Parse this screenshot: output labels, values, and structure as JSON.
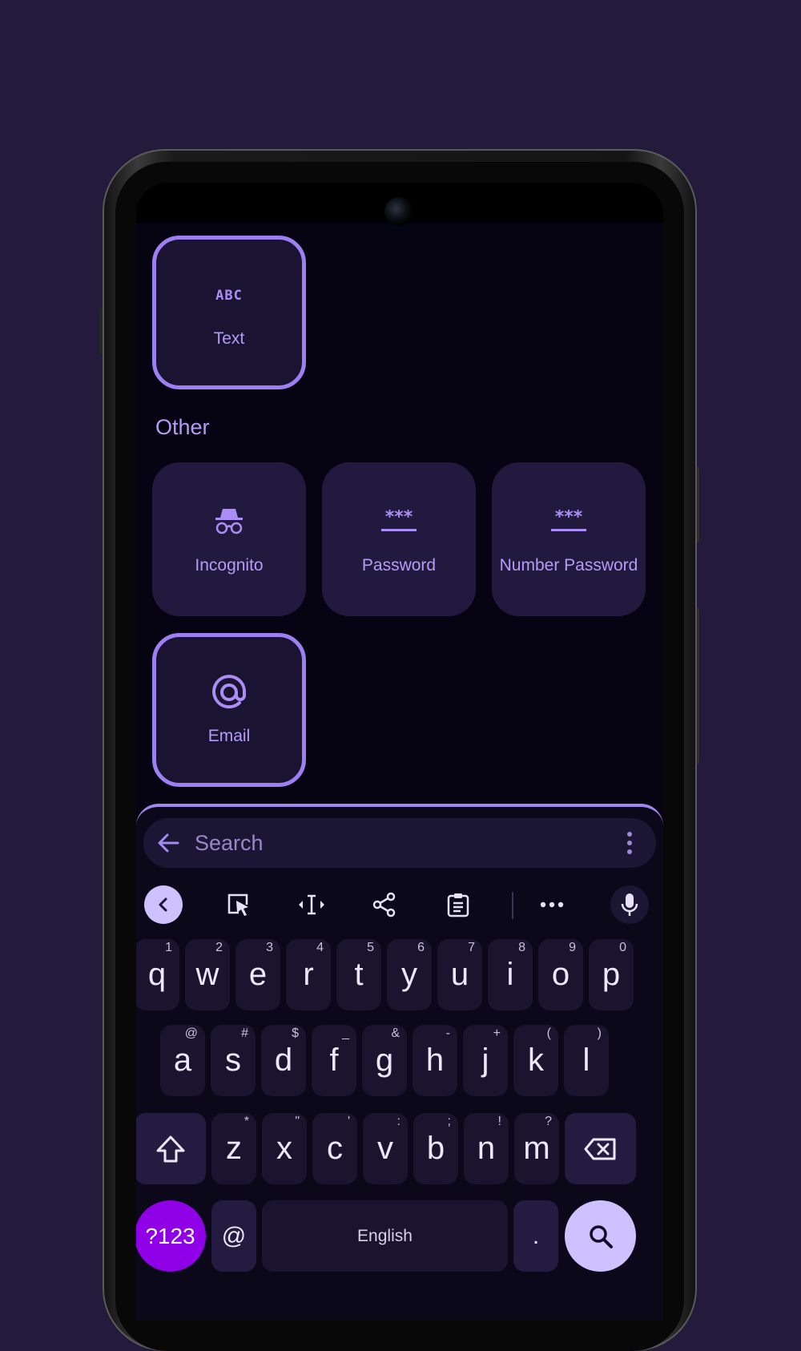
{
  "colors": {
    "background": "#231a3c",
    "accent": "#9d7ff2",
    "tile": "#221a3e",
    "key": "#1a142e",
    "symbols_key": "#8f00e6",
    "action_key": "#cdc2ff"
  },
  "input_types": {
    "text_tile": {
      "label": "Text",
      "icon": "abc-icon",
      "selected": true
    },
    "section_label": "Other",
    "other": [
      {
        "label": "Incognito",
        "icon": "incognito-icon"
      },
      {
        "label": "Password",
        "icon": "password-icon"
      },
      {
        "label": "Number Password",
        "icon": "number-password-icon"
      }
    ],
    "email_tile": {
      "label": "Email",
      "icon": "at-sign-icon",
      "selected": true
    }
  },
  "keyboard": {
    "search": {
      "placeholder": "Search",
      "back_icon": "arrow-left-icon",
      "more_icon": "more-vert-icon"
    },
    "toolbar": [
      "chevron-left-icon",
      "select-icon",
      "text-cursor-icon",
      "share-icon",
      "clipboard-icon",
      "more-horiz-icon",
      "mic-icon"
    ],
    "row1": [
      {
        "k": "q",
        "h": "1"
      },
      {
        "k": "w",
        "h": "2"
      },
      {
        "k": "e",
        "h": "3"
      },
      {
        "k": "r",
        "h": "4"
      },
      {
        "k": "t",
        "h": "5"
      },
      {
        "k": "y",
        "h": "6"
      },
      {
        "k": "u",
        "h": "7"
      },
      {
        "k": "i",
        "h": "8"
      },
      {
        "k": "o",
        "h": "9"
      },
      {
        "k": "p",
        "h": "0"
      }
    ],
    "row2": [
      {
        "k": "a",
        "h": "@"
      },
      {
        "k": "s",
        "h": "#"
      },
      {
        "k": "d",
        "h": "$"
      },
      {
        "k": "f",
        "h": "_"
      },
      {
        "k": "g",
        "h": "&"
      },
      {
        "k": "h",
        "h": "-"
      },
      {
        "k": "j",
        "h": "+"
      },
      {
        "k": "k",
        "h": "("
      },
      {
        "k": "l",
        "h": ")"
      }
    ],
    "row3": [
      {
        "k": "z",
        "h": "*"
      },
      {
        "k": "x",
        "h": "\""
      },
      {
        "k": "c",
        "h": "'"
      },
      {
        "k": "v",
        "h": ":"
      },
      {
        "k": "b",
        "h": ";"
      },
      {
        "k": "n",
        "h": "!"
      },
      {
        "k": "m",
        "h": "?"
      }
    ],
    "symbols_label": "?123",
    "at_label": "@",
    "space_label": "English",
    "period_label": ".",
    "shift_icon": "shift-icon",
    "backspace_icon": "backspace-icon",
    "action_icon": "search-icon"
  }
}
